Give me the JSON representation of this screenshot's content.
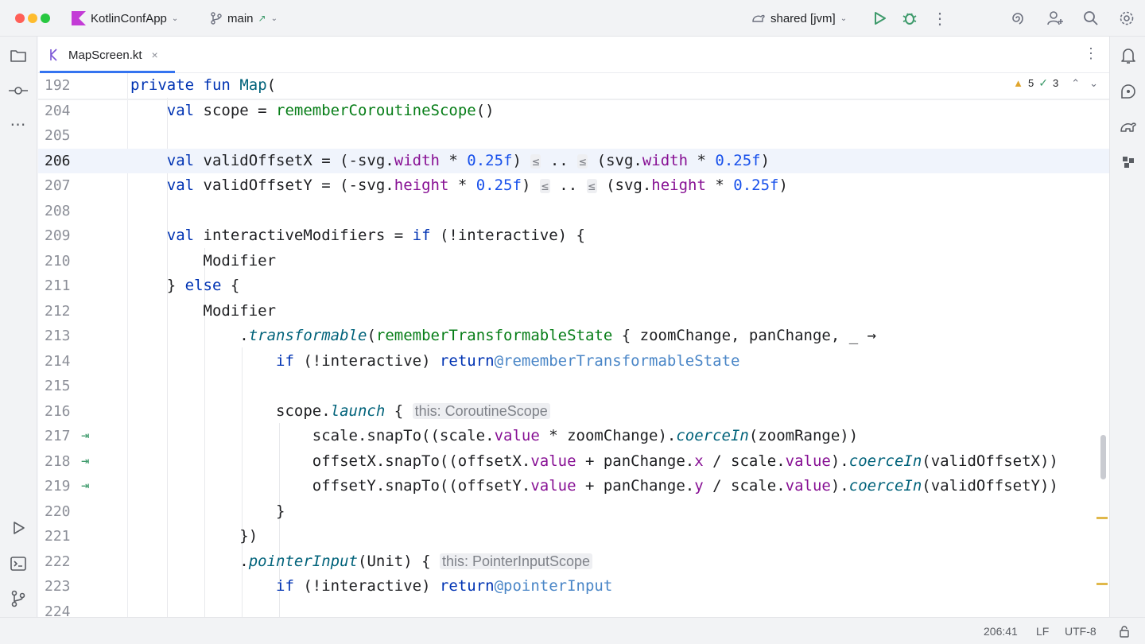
{
  "titlebar": {
    "project": "KotlinConfApp",
    "branch": "main",
    "run_config": "shared [jvm]"
  },
  "tab": {
    "file_name": "MapScreen.kt"
  },
  "inspections": {
    "warnings": "5",
    "weak_warnings": "3"
  },
  "code": {
    "lines": [
      {
        "n": "192",
        "text": "private fun Map("
      },
      {
        "n": "204",
        "text": "    val scope = rememberCoroutineScope()"
      },
      {
        "n": "205",
        "text": ""
      },
      {
        "n": "206",
        "text": "    val validOffsetX = (-svg.width * 0.25f) ≤ .. ≤ (svg.width * 0.25f)"
      },
      {
        "n": "207",
        "text": "    val validOffsetY = (-svg.height * 0.25f) ≤ .. ≤ (svg.height * 0.25f)"
      },
      {
        "n": "208",
        "text": ""
      },
      {
        "n": "209",
        "text": "    val interactiveModifiers = if (!interactive) {"
      },
      {
        "n": "210",
        "text": "        Modifier"
      },
      {
        "n": "211",
        "text": "    } else {"
      },
      {
        "n": "212",
        "text": "        Modifier"
      },
      {
        "n": "213",
        "text": "            .transformable(rememberTransformableState { zoomChange, panChange, _ →"
      },
      {
        "n": "214",
        "text": "                if (!interactive) return@rememberTransformableState"
      },
      {
        "n": "215",
        "text": ""
      },
      {
        "n": "216",
        "text": "                scope.launch { this: CoroutineScope"
      },
      {
        "n": "217",
        "text": "                    scale.snapTo((scale.value * zoomChange).coerceIn(zoomRange))"
      },
      {
        "n": "218",
        "text": "                    offsetX.snapTo((offsetX.value + panChange.x / scale.value).coerceIn(validOffsetX))"
      },
      {
        "n": "219",
        "text": "                    offsetY.snapTo((offsetY.value + panChange.y / scale.value).coerceIn(validOffsetY))"
      },
      {
        "n": "220",
        "text": "                }"
      },
      {
        "n": "221",
        "text": "            })"
      },
      {
        "n": "222",
        "text": "            .pointerInput(Unit) { this: PointerInputScope"
      },
      {
        "n": "223",
        "text": "                if (!interactive) return@pointerInput"
      },
      {
        "n": "224",
        "text": ""
      }
    ],
    "hints": {
      "coroutine_scope": "this: CoroutineScope",
      "pointer_input_scope": "this: PointerInputScope",
      "le": "≤",
      "range": ".."
    }
  },
  "statusbar": {
    "position": "206:41",
    "line_separator": "LF",
    "encoding": "UTF-8"
  },
  "colors": {
    "accent": "#3574f0",
    "keyword": "#0033b3",
    "number": "#1750eb",
    "property": "#871094",
    "call": "#067d17"
  },
  "icons": [
    "project-icon",
    "commit-icon",
    "more-icon",
    "run-icon",
    "terminal-icon",
    "git-icon",
    "notifications-icon",
    "ai-assistant-icon",
    "gradle-icon",
    "plugin-icon",
    "search-icon",
    "settings-icon",
    "add-user-icon",
    "copilot-icon",
    "debug-icon",
    "lock-icon"
  ]
}
